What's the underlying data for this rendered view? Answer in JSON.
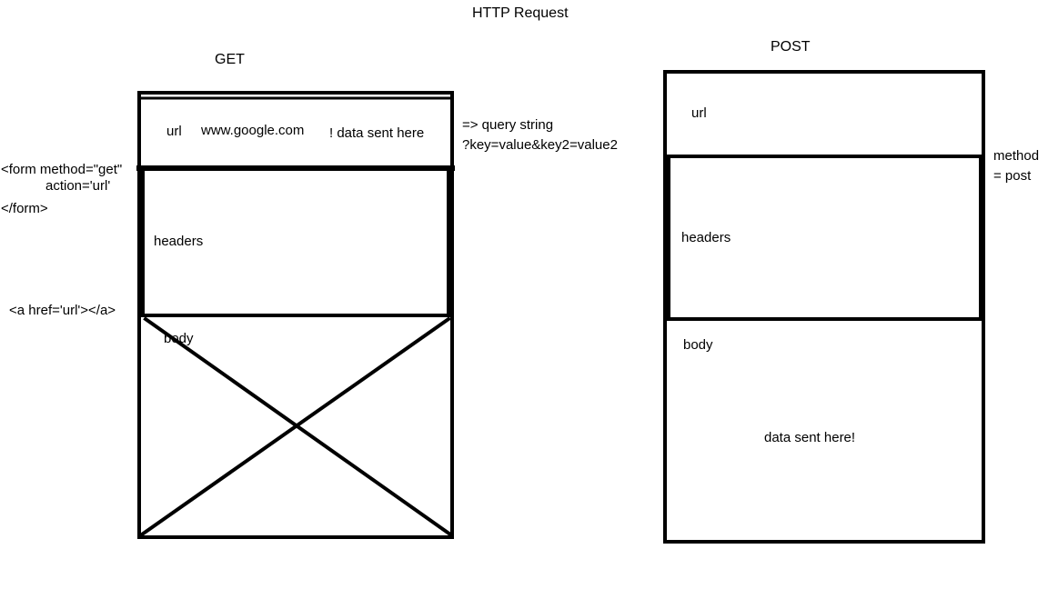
{
  "title": "HTTP Request",
  "get": {
    "heading": "GET",
    "url_label": "url",
    "url_value": "www.google.com",
    "url_note": "! data sent here",
    "headers_label": "headers",
    "body_label": "body",
    "query_note_line1": "=> query string",
    "query_note_line2": "?key=value&key2=value2",
    "form_line1": "<form method=\"get\"",
    "form_line2": "action='url'",
    "form_line3": "</form>",
    "anchor_tag": "<a href='url'></a>"
  },
  "post": {
    "heading": "POST",
    "url_label": "url",
    "headers_label": "headers",
    "body_label": "body",
    "body_note": "data sent here!",
    "method_note_line1": "method",
    "method_note_line2": "= post"
  },
  "colors": {
    "stroke": "#000000",
    "background": "#ffffff"
  }
}
